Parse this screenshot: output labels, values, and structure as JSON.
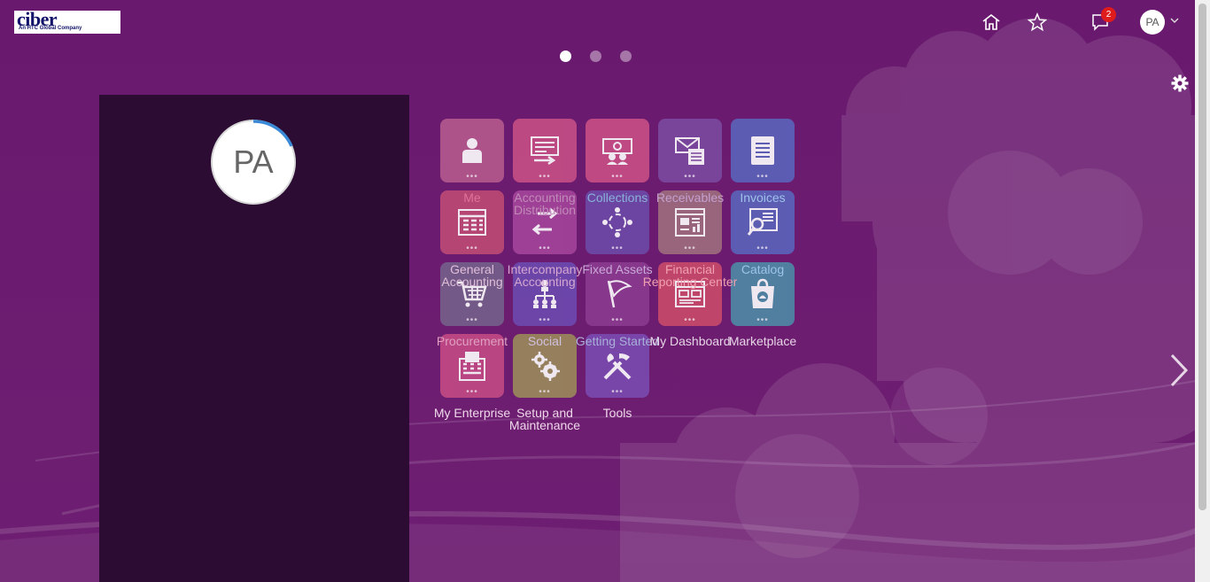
{
  "brand": {
    "name": "ciber",
    "tagline": "An HTC Global Company"
  },
  "header": {
    "icons": [
      "home-icon",
      "star-icon",
      "notifications-icon"
    ],
    "notification_count": "2",
    "user_initials": "PA"
  },
  "pager": {
    "pages": 3,
    "active": 1
  },
  "profile": {
    "initials": "PA"
  },
  "colors": {
    "background": "#6a1b6e",
    "panel": "#2d0c33"
  },
  "tiles": [
    {
      "label": "Me",
      "color": "#b55a8e",
      "label_color": "#e0729a",
      "icon": "person-icon"
    },
    {
      "label": "Accounting Distribution",
      "color": "#c64f86",
      "label_color": "#c08ab8",
      "icon": "ledger-transfer-icon"
    },
    {
      "label": "Collections",
      "color": "#c94f86",
      "label_color": "#8ab1d8",
      "icon": "money-people-icon"
    },
    {
      "label": "Receivables",
      "color": "#7a4aa0",
      "label_color": "#c3a0cf",
      "icon": "envelope-list-icon"
    },
    {
      "label": "Invoices",
      "color": "#5b64bb",
      "label_color": "#9ec2e8",
      "icon": "document-lines-icon"
    },
    {
      "label": "General Accounting",
      "color": "#bd4a74",
      "label_color": "#e0bed8",
      "icon": "spreadsheet-icon"
    },
    {
      "label": "Intercompany Accounting",
      "color": "#a4449a",
      "label_color": "#d5a6cf",
      "icon": "exchange-icon"
    },
    {
      "label": "Fixed Assets",
      "color": "#6c4aa8",
      "label_color": "#c9a8d6",
      "icon": "assets-cycle-icon"
    },
    {
      "label": "Financial Reporting Center",
      "color": "#9d6d7e",
      "label_color": "#f0a0b0",
      "icon": "report-chart-icon"
    },
    {
      "label": "Catalog",
      "color": "#5b64bb",
      "label_color": "#9ec2e8",
      "icon": "catalog-search-icon"
    },
    {
      "label": "Procurement",
      "color": "#74608a",
      "label_color": "#e0a0c0",
      "icon": "cart-icon"
    },
    {
      "label": "Social",
      "color": "#6d4ab0",
      "label_color": "#d0c0e0",
      "icon": "social-network-icon"
    },
    {
      "label": "Getting Started",
      "color": "#8a3b90",
      "label_color": "#a9b0d8",
      "icon": "flag-icon"
    },
    {
      "label": "My Dashboard",
      "color": "#c84a6a",
      "label_color": "#e6d4e6",
      "icon": "dashboard-icon"
    },
    {
      "label": "Marketplace",
      "color": "#4d8aa6",
      "label_color": "#e6d4e6",
      "icon": "shopping-bag-icon"
    },
    {
      "label": "My Enterprise",
      "color": "#c24a84",
      "label_color": "#efd8ea",
      "icon": "building-icon"
    },
    {
      "label": "Setup and Maintenance",
      "color": "#9a8a5a",
      "label_color": "#efd8ea",
      "icon": "gears-icon"
    },
    {
      "label": "Tools",
      "color": "#7a4ab0",
      "label_color": "#efd8ea",
      "icon": "tools-icon"
    }
  ]
}
